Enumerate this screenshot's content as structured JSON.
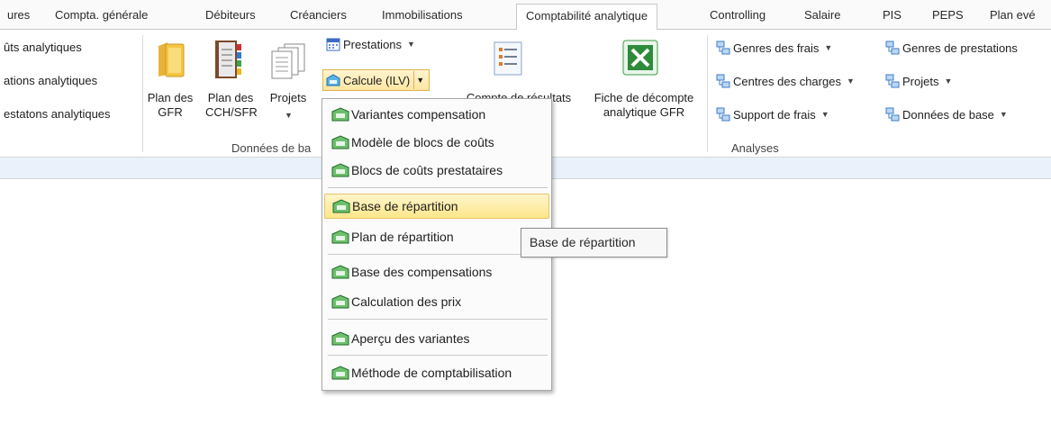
{
  "tabs": [
    {
      "label": "ures"
    },
    {
      "label": "Compta. générale"
    },
    {
      "label": "Débiteurs"
    },
    {
      "label": "Créanciers"
    },
    {
      "label": "Immobilisations"
    },
    {
      "label": "Comptabilité analytique",
      "active": true
    },
    {
      "label": "Controlling"
    },
    {
      "label": "Salaire"
    },
    {
      "label": "PIS"
    },
    {
      "label": "PEPS"
    },
    {
      "label": "Plan evé"
    }
  ],
  "ribbon": {
    "left_items": [
      "ûts analytiques",
      "ations analytiques",
      "estatons analytiques"
    ],
    "plan_gfr": "Plan des\nGFR",
    "plan_cch": "Plan des\nCCH/SFR",
    "projets": "Projets",
    "prestations": "Prestations",
    "calcule": "Calcule (ILV)",
    "compte_resultats": "Compte de résultats",
    "fiche": "Fiche de décompte\nanalytique GFR",
    "analyses_col1": [
      "Genres des frais",
      "Centres des charges",
      "Support de frais"
    ],
    "analyses_col2": [
      "Genres de prestations",
      "Projets",
      "Données de base"
    ],
    "group_donnees": "Données de ba",
    "group_analyses": "Analyses"
  },
  "menu": {
    "items": [
      "Variantes compensation",
      "Modèle de blocs de coûts",
      "Blocs de coûts prestataires",
      "Base de répartition",
      "Plan de répartition",
      "Base des compensations",
      "Calculation des prix",
      "Aperçu des variantes",
      "Méthode de comptabilisation"
    ],
    "hover_index": 3
  },
  "tooltip": "Base de répartition",
  "colors": {
    "accent_tab_border": "#c8c8c8",
    "hover_bg": "#fde68a",
    "strip_bg": "#eaf1fb"
  }
}
